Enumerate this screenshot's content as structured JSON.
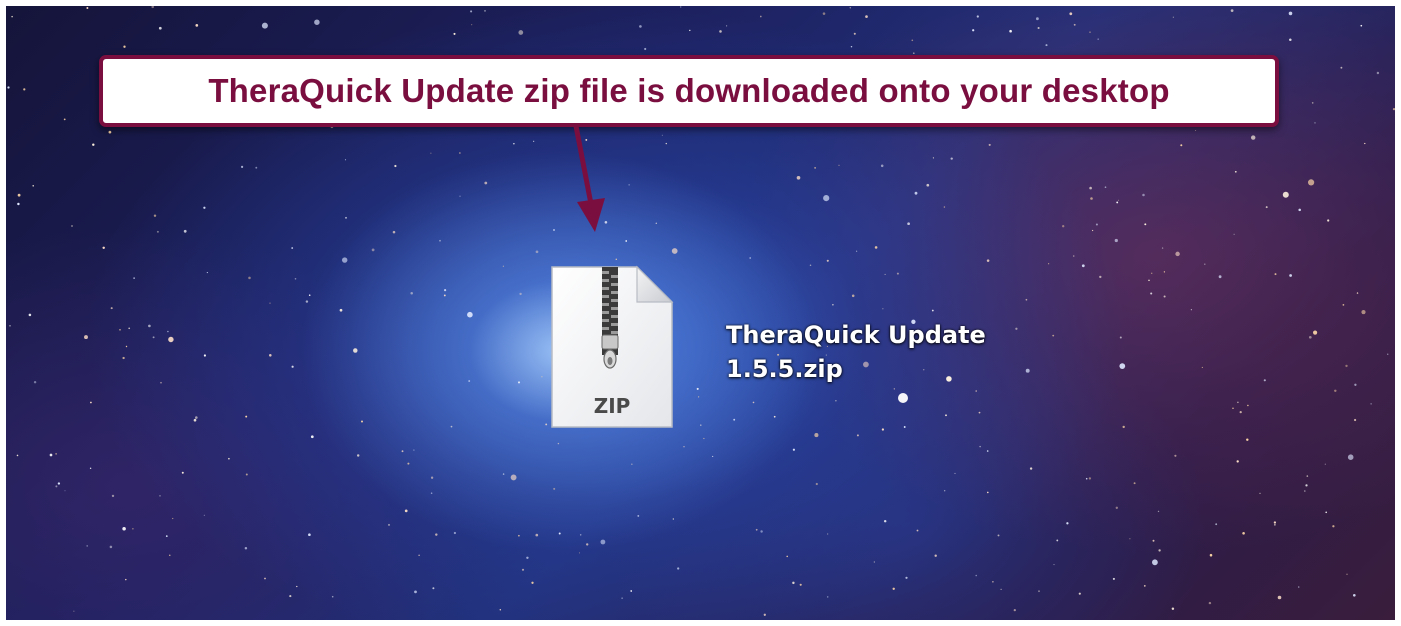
{
  "callout": {
    "text": "TheraQuick Update zip file is downloaded onto your desktop"
  },
  "desktop_icon": {
    "badge": "ZIP",
    "name_line1": "TheraQuick Update",
    "name_line2": "1.5.5.zip",
    "icon": "zip-archive-icon"
  },
  "colors": {
    "callout_border": "#7a0f3f",
    "callout_text": "#7a0f3f",
    "arrow": "#7a0f3f"
  }
}
